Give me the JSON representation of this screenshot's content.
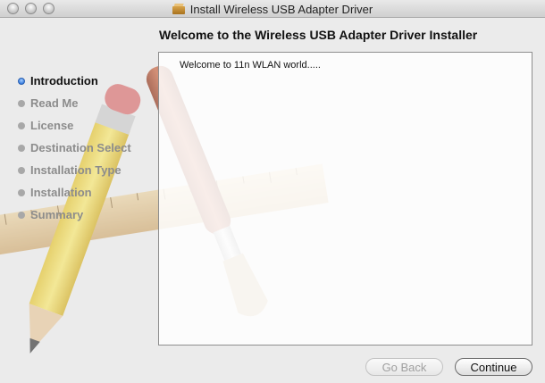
{
  "window": {
    "title": "Install Wireless USB Adapter Driver"
  },
  "header": {
    "title": "Welcome to the Wireless USB Adapter Driver Installer"
  },
  "sidebar": {
    "steps": [
      {
        "label": "Introduction",
        "active": true
      },
      {
        "label": "Read Me",
        "active": false
      },
      {
        "label": "License",
        "active": false
      },
      {
        "label": "Destination Select",
        "active": false
      },
      {
        "label": "Installation Type",
        "active": false
      },
      {
        "label": "Installation",
        "active": false
      },
      {
        "label": "Summary",
        "active": false
      }
    ]
  },
  "content": {
    "text": "Welcome to 11n WLAN world....."
  },
  "buttons": {
    "back_label": "Go Back",
    "back_enabled": false,
    "continue_label": "Continue"
  },
  "colors": {
    "active_step": "#3a7fe0",
    "inactive_step_text": "#8c8c8c"
  }
}
